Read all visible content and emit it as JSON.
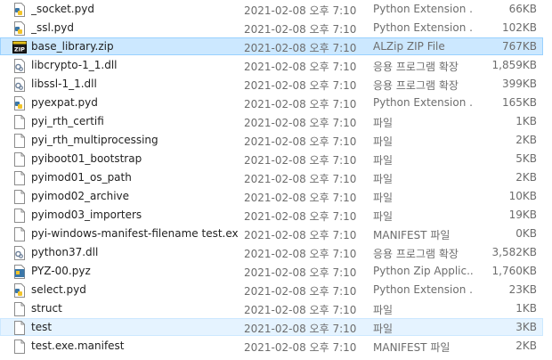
{
  "files": [
    {
      "name": "_socket.pyd",
      "date": "2021-02-08 오후 7:10",
      "type": "Python Extension ...",
      "size": "66KB",
      "icon": "python-file-icon",
      "state": "normal"
    },
    {
      "name": "_ssl.pyd",
      "date": "2021-02-08 오후 7:10",
      "type": "Python Extension ...",
      "size": "102KB",
      "icon": "python-file-icon",
      "state": "normal"
    },
    {
      "name": "base_library.zip",
      "date": "2021-02-08 오후 7:10",
      "type": "ALZip ZIP File",
      "size": "767KB",
      "icon": "zip-file-icon",
      "state": "selected"
    },
    {
      "name": "libcrypto-1_1.dll",
      "date": "2021-02-08 오후 7:10",
      "type": "응용 프로그램 확장",
      "size": "1,859KB",
      "icon": "dll-file-icon",
      "state": "normal"
    },
    {
      "name": "libssl-1_1.dll",
      "date": "2021-02-08 오후 7:10",
      "type": "응용 프로그램 확장",
      "size": "399KB",
      "icon": "dll-file-icon",
      "state": "normal"
    },
    {
      "name": "pyexpat.pyd",
      "date": "2021-02-08 오후 7:10",
      "type": "Python Extension ...",
      "size": "165KB",
      "icon": "python-file-icon",
      "state": "normal"
    },
    {
      "name": "pyi_rth_certifi",
      "date": "2021-02-08 오후 7:10",
      "type": "파일",
      "size": "1KB",
      "icon": "blank-file-icon",
      "state": "normal"
    },
    {
      "name": "pyi_rth_multiprocessing",
      "date": "2021-02-08 오후 7:10",
      "type": "파일",
      "size": "2KB",
      "icon": "blank-file-icon",
      "state": "normal"
    },
    {
      "name": "pyiboot01_bootstrap",
      "date": "2021-02-08 오후 7:10",
      "type": "파일",
      "size": "5KB",
      "icon": "blank-file-icon",
      "state": "normal"
    },
    {
      "name": "pyimod01_os_path",
      "date": "2021-02-08 오후 7:10",
      "type": "파일",
      "size": "2KB",
      "icon": "blank-file-icon",
      "state": "normal"
    },
    {
      "name": "pyimod02_archive",
      "date": "2021-02-08 오후 7:10",
      "type": "파일",
      "size": "10KB",
      "icon": "blank-file-icon",
      "state": "normal"
    },
    {
      "name": "pyimod03_importers",
      "date": "2021-02-08 오후 7:10",
      "type": "파일",
      "size": "19KB",
      "icon": "blank-file-icon",
      "state": "normal"
    },
    {
      "name": "pyi-windows-manifest-filename test.exe....",
      "date": "2021-02-08 오후 7:10",
      "type": "MANIFEST 파일",
      "size": "0KB",
      "icon": "blank-file-icon",
      "state": "normal"
    },
    {
      "name": "python37.dll",
      "date": "2021-02-08 오후 7:10",
      "type": "응용 프로그램 확장",
      "size": "3,582KB",
      "icon": "dll-file-icon",
      "state": "normal"
    },
    {
      "name": "PYZ-00.pyz",
      "date": "2021-02-08 오후 7:10",
      "type": "Python Zip Applic...",
      "size": "1,760KB",
      "icon": "pyz-file-icon",
      "state": "normal"
    },
    {
      "name": "select.pyd",
      "date": "2021-02-08 오후 7:10",
      "type": "Python Extension ...",
      "size": "23KB",
      "icon": "python-file-icon",
      "state": "normal"
    },
    {
      "name": "struct",
      "date": "2021-02-08 오후 7:10",
      "type": "파일",
      "size": "1KB",
      "icon": "blank-file-icon",
      "state": "normal"
    },
    {
      "name": "test",
      "date": "2021-02-08 오후 7:10",
      "type": "파일",
      "size": "3KB",
      "icon": "blank-file-icon",
      "state": "hover"
    },
    {
      "name": "test.exe.manifest",
      "date": "2021-02-08 오후 7:10",
      "type": "MANIFEST 파일",
      "size": "2KB",
      "icon": "blank-file-icon",
      "state": "normal"
    }
  ],
  "colors": {
    "selected_bg": "#cce8ff",
    "hover_bg": "#e5f3ff",
    "secondary_text": "#6d6d6d"
  }
}
